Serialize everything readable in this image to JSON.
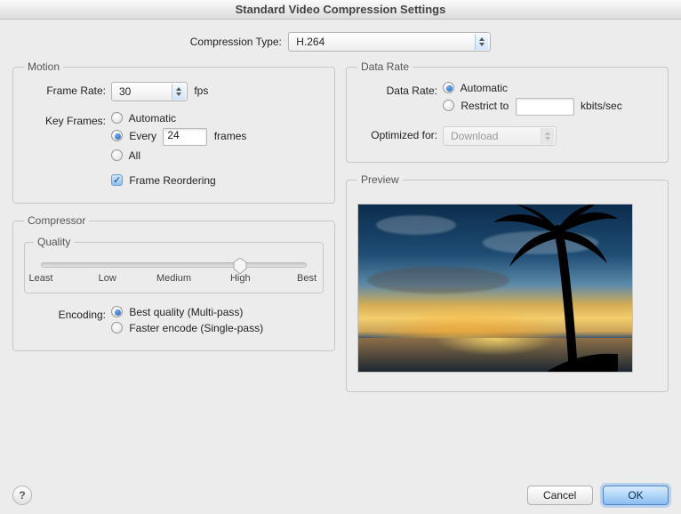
{
  "window": {
    "title": "Standard Video Compression Settings"
  },
  "compression": {
    "label": "Compression Type:",
    "value": "H.264"
  },
  "motion": {
    "legend": "Motion",
    "frame_rate": {
      "label": "Frame Rate:",
      "value": "30",
      "unit": "fps"
    },
    "key_frames": {
      "label": "Key Frames:",
      "options": {
        "automatic": "Automatic",
        "every": "Every",
        "all": "All"
      },
      "selected": "every",
      "interval": "24",
      "interval_unit": "frames"
    },
    "frame_reordering": {
      "label": "Frame Reordering",
      "checked": true
    }
  },
  "data_rate": {
    "legend": "Data Rate",
    "label": "Data Rate:",
    "options": {
      "automatic": "Automatic",
      "restrict": "Restrict to"
    },
    "selected": "automatic",
    "restrict_value": "",
    "restrict_unit": "kbits/sec",
    "optimized": {
      "label": "Optimized for:",
      "value": "Download"
    }
  },
  "compressor": {
    "legend": "Compressor",
    "quality": {
      "legend": "Quality",
      "ticks": [
        "Least",
        "Low",
        "Medium",
        "High",
        "Best"
      ],
      "value_index": 3
    },
    "encoding": {
      "label": "Encoding:",
      "options": {
        "best": "Best quality (Multi-pass)",
        "faster": "Faster encode (Single-pass)"
      },
      "selected": "best"
    }
  },
  "preview": {
    "legend": "Preview"
  },
  "footer": {
    "cancel": "Cancel",
    "ok": "OK",
    "help": "?"
  }
}
